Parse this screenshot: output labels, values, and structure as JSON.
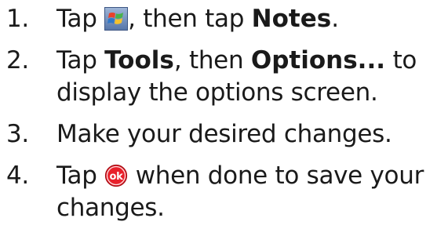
{
  "steps": [
    {
      "number": "1.",
      "text_a": "Tap",
      "icon": "windows-start-icon",
      "text_b": ", then tap",
      "bold_a": "Notes",
      "text_c": "."
    },
    {
      "number": "2.",
      "text_a": "Tap",
      "bold_a": "Tools",
      "text_b": ", then",
      "bold_b": "Options...",
      "text_c": "to display the options screen."
    },
    {
      "number": "3.",
      "text_a": "Make your desired changes."
    },
    {
      "number": "4.",
      "text_a": "Tap",
      "icon": "ok-button-icon",
      "text_b": "when done to save your changes."
    }
  ],
  "colors": {
    "ok_icon": "#e8202a",
    "text": "#1a1a1a"
  }
}
